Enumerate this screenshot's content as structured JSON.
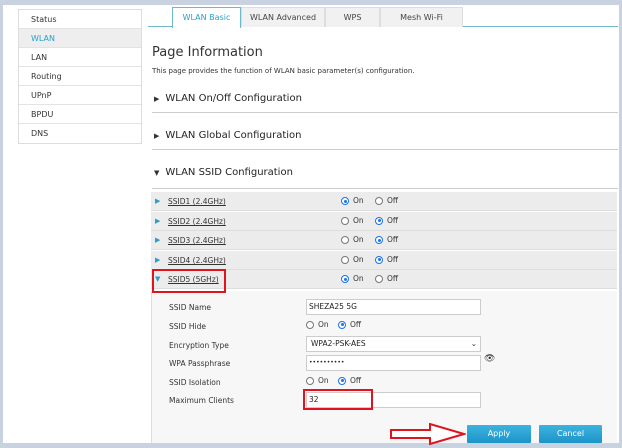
{
  "sidebar": {
    "items": [
      "Status",
      "WLAN",
      "LAN",
      "Routing",
      "UPnP",
      "BPDU",
      "DNS"
    ],
    "active": "WLAN"
  },
  "tabs": [
    "WLAN Basic",
    "WLAN Advanced",
    "WPS",
    "Mesh Wi-Fi"
  ],
  "page": {
    "title": "Page Information",
    "description": "This page provides the function of WLAN basic parameter(s) configuration."
  },
  "sections": [
    "WLAN On/Off Configuration",
    "WLAN Global Configuration",
    "WLAN SSID Configuration"
  ],
  "radio_labels": {
    "on": "On",
    "off": "Off"
  },
  "ssids": [
    {
      "name": "SSID1 (2.4GHz)",
      "state": "On"
    },
    {
      "name": "SSID2 (2.4GHz)",
      "state": "Off"
    },
    {
      "name": "SSID3 (2.4GHz)",
      "state": "Off"
    },
    {
      "name": "SSID4 (2.4GHz)",
      "state": "Off"
    },
    {
      "name": "SSID5 (5GHz)",
      "state": "On",
      "expanded": true
    }
  ],
  "ssid5": {
    "labels": {
      "name": "SSID Name",
      "hide": "SSID Hide",
      "enc": "Encryption Type",
      "pass": "WPA Passphrase",
      "iso": "SSID Isolation",
      "max": "Maximum Clients"
    },
    "name": "SHEZA25 5G",
    "hide": "Off",
    "encryption": "WPA2-PSK-AES",
    "passphrase": "••••••••••",
    "isolation": "Off",
    "max_clients": "32"
  },
  "buttons": {
    "apply": "Apply",
    "cancel": "Cancel"
  },
  "colors": {
    "accent": "#2a9fc9",
    "highlight": "#e0141e"
  }
}
